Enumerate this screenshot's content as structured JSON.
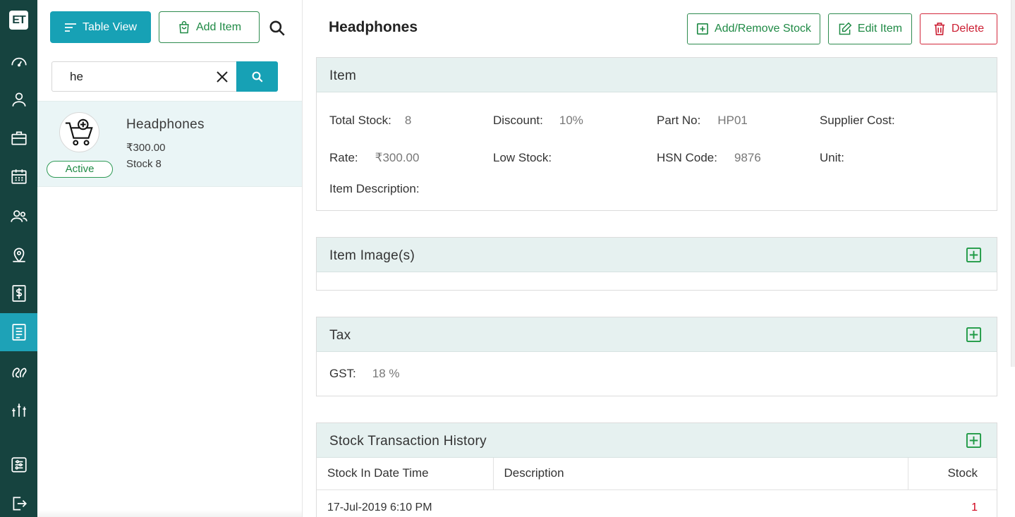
{
  "logo": "ET",
  "rail": {
    "icons": [
      "dashboard-icon",
      "user-icon",
      "briefcase-icon",
      "calendar-icon",
      "team-icon",
      "location-icon",
      "dollar-icon",
      "list-icon",
      "leads-icon",
      "reports-icon",
      "settings-icon",
      "logout-icon"
    ],
    "active": "list-icon",
    "accent": "#1ea2b7",
    "background": "#16433f"
  },
  "toolbar": {
    "table_view_label": "Table View",
    "add_item_label": "Add Item"
  },
  "search": {
    "value": "he"
  },
  "items": [
    {
      "name": "Headphones",
      "price": "₹300.00",
      "stock_label": "Stock",
      "stock": "8",
      "status": "Active"
    }
  ],
  "detail": {
    "title": "Headphones",
    "buttons": {
      "stock": "Add/Remove Stock",
      "edit": "Edit Item",
      "delete": "Delete"
    },
    "item_section": {
      "title": "Item",
      "fields": {
        "total_stock_label": "Total Stock:",
        "total_stock": "8",
        "discount_label": "Discount:",
        "discount": "10%",
        "part_no_label": "Part No:",
        "part_no": "HP01",
        "supplier_cost_label": "Supplier Cost:",
        "supplier_cost": "",
        "rate_label": "Rate:",
        "rate": "₹300.00",
        "low_stock_label": "Low Stock:",
        "low_stock": "",
        "hsn_label": "HSN Code:",
        "hsn": "9876",
        "unit_label": "Unit:",
        "unit": "",
        "description_label": "Item Description:",
        "description": ""
      }
    },
    "images_section": {
      "title": "Item Image(s)"
    },
    "tax_section": {
      "title": "Tax",
      "gst_label": "GST:",
      "gst": "18 %"
    },
    "history_section": {
      "title": "Stock Transaction History",
      "columns": [
        "Stock In Date Time",
        "Description",
        "Stock"
      ],
      "rows": [
        {
          "datetime": "17-Jul-2019 6:10 PM",
          "description": "",
          "stock": "1"
        }
      ]
    }
  },
  "colors": {
    "primary": "#17a1b5",
    "success": "#1f8a45",
    "danger": "#cc1f33",
    "section_header": "#e6f1f0"
  }
}
